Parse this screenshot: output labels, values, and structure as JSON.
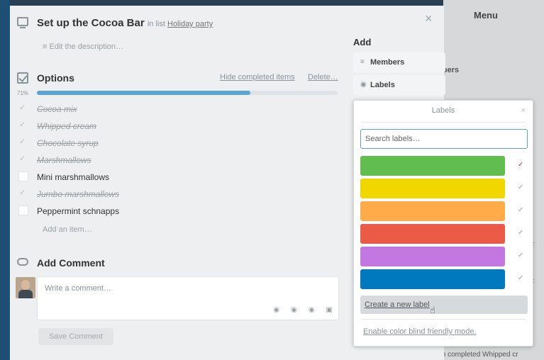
{
  "background": {
    "menu_label": "Menu",
    "snippet_members": "mbers",
    "snippet_right_1": "C",
    "snippet_right_2": "C",
    "snippet_bottom": "th completed Whipped cr"
  },
  "card": {
    "title": "Set up the Cocoa Bar",
    "in_list_prefix": "in list",
    "list_name": "Holiday party",
    "close_glyph": "×",
    "edit_description": "Edit the description…"
  },
  "checklist": {
    "title": "Options",
    "hide_completed": "Hide completed items",
    "delete": "Delete…",
    "percent_label": "71%",
    "progress": 0.71,
    "items": [
      {
        "label": "Cocoa mix",
        "done": true
      },
      {
        "label": "Whipped cream",
        "done": true
      },
      {
        "label": "Chocolate syrup",
        "done": true
      },
      {
        "label": "Marshmallows",
        "done": true
      },
      {
        "label": "Mini marshmallows",
        "done": false
      },
      {
        "label": "Jumbo marshmallows",
        "done": true
      },
      {
        "label": "Peppermint schnapps",
        "done": false
      }
    ],
    "add_item": "Add an item…"
  },
  "comment": {
    "title": "Add Comment",
    "placeholder": "Write a comment…",
    "save_label": "Save Comment",
    "tools": [
      "attach-icon",
      "mention-icon",
      "emoji-icon",
      "card-icon"
    ]
  },
  "sidebar": {
    "heading": "Add",
    "members_label": "Members",
    "labels_label": "Labels"
  },
  "labels_popover": {
    "title": "Labels",
    "close_glyph": "×",
    "search_placeholder": "Search labels…",
    "labels": [
      {
        "color": "#61bd4f",
        "selected": true
      },
      {
        "color": "#f2d600",
        "selected": false
      },
      {
        "color": "#ffab4a",
        "selected": false
      },
      {
        "color": "#eb5a46",
        "selected": false
      },
      {
        "color": "#c377e0",
        "selected": false
      },
      {
        "color": "#0079bf",
        "selected": false
      }
    ],
    "create_label": "Create a new label",
    "colorblind_mode": "Enable color blind friendly mode."
  }
}
